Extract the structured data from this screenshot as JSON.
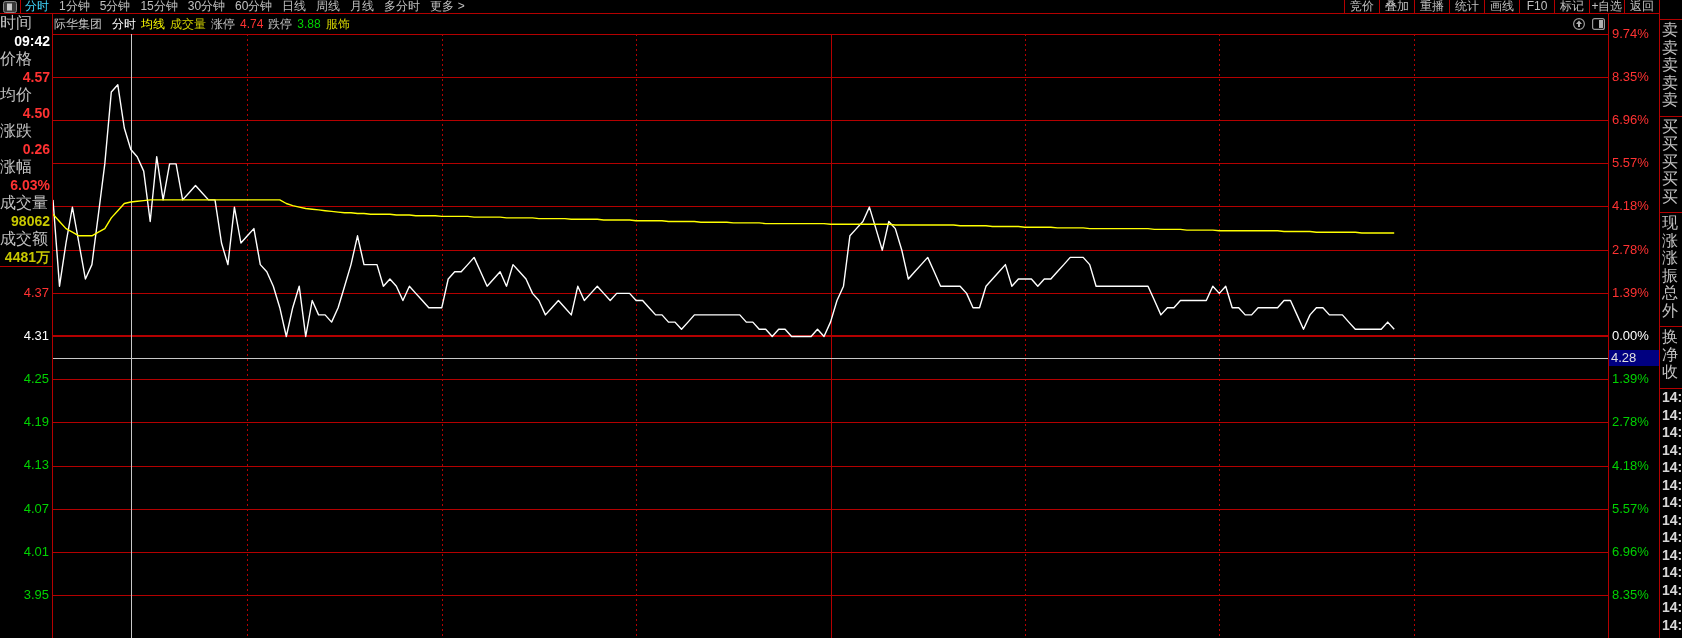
{
  "toolbar": {
    "periods": [
      {
        "label": "分时",
        "selected": true
      },
      {
        "label": "1分钟",
        "selected": false
      },
      {
        "label": "5分钟",
        "selected": false
      },
      {
        "label": "15分钟",
        "selected": false
      },
      {
        "label": "30分钟",
        "selected": false
      },
      {
        "label": "60分钟",
        "selected": false
      },
      {
        "label": "日线",
        "selected": false
      },
      {
        "label": "周线",
        "selected": false
      },
      {
        "label": "月线",
        "selected": false
      },
      {
        "label": "多分时",
        "selected": false
      },
      {
        "label": "更多 >",
        "selected": false
      }
    ],
    "actions": [
      "竞价",
      "叠加",
      "重播",
      "统计",
      "画线",
      "F10",
      "标记",
      "+自选",
      "返回"
    ]
  },
  "info_panel": [
    {
      "label": "时间",
      "value": "09:42",
      "color": "#ffffff"
    },
    {
      "label": "价格",
      "value": "4.57",
      "color": "#ff3232"
    },
    {
      "label": "均价",
      "value": "4.50",
      "color": "#ff3232"
    },
    {
      "label": "涨跌",
      "value": "0.26",
      "color": "#ff3232"
    },
    {
      "label": "涨幅",
      "value": "6.03%",
      "color": "#ff3232"
    },
    {
      "label": "成交量",
      "value": "98062",
      "color": "#c8c800"
    },
    {
      "label": "成交额",
      "value": "4481万",
      "color": "#c8c800"
    }
  ],
  "chart": {
    "stock": "际华集团",
    "legend": [
      {
        "text": "成交量",
        "kind": "indicator"
      },
      {
        "text": "涨停",
        "kind": "label"
      },
      {
        "text": "4.74",
        "kind": "rise"
      },
      {
        "text": "跌停",
        "kind": "label"
      },
      {
        "text": "3.88",
        "kind": "fall"
      },
      {
        "text": "服饰",
        "kind": "tag"
      }
    ],
    "chart_data": {
      "type": "line",
      "grid": true,
      "ylim": [
        3.89,
        4.73
      ],
      "y2lim": [
        -9.74,
        9.74
      ],
      "categories": [
        null,
        null,
        null,
        null,
        null,
        null,
        null,
        null,
        null,
        null,
        null,
        null,
        null,
        null,
        null,
        null,
        null,
        null,
        null,
        null,
        null,
        null,
        null,
        null,
        null,
        null,
        null,
        null,
        null,
        null,
        null,
        null,
        null,
        null,
        null,
        null,
        null,
        null,
        null,
        null,
        null,
        null,
        null,
        null,
        null,
        null,
        null,
        null,
        null,
        null,
        null,
        null,
        null,
        null,
        null,
        null,
        null,
        null,
        null,
        null,
        null,
        null,
        null,
        null,
        null,
        null,
        null,
        null,
        null,
        null,
        null,
        null,
        null,
        null,
        null,
        null,
        null,
        null,
        null,
        null,
        null,
        null,
        null,
        null,
        null,
        null,
        null,
        null,
        null,
        null,
        null,
        null,
        null,
        null,
        null,
        null,
        null,
        null,
        null,
        null,
        null,
        null,
        null,
        null,
        null,
        null,
        null,
        null,
        null,
        null,
        null,
        null,
        null,
        null,
        null,
        null,
        null,
        null,
        null,
        null,
        null,
        null,
        null,
        null,
        null,
        null,
        null,
        null,
        null,
        null,
        null,
        null,
        null,
        null,
        null,
        null,
        null,
        null,
        null,
        null,
        null,
        null,
        null,
        null,
        null,
        null,
        null,
        null,
        null,
        null,
        null,
        null,
        null,
        null,
        null,
        null,
        null,
        null,
        null,
        null,
        null,
        null,
        null,
        null,
        null,
        null,
        null,
        null,
        null,
        null,
        null,
        null,
        null,
        null,
        null,
        null,
        null,
        null,
        null,
        null,
        null,
        null,
        null,
        null,
        null,
        null,
        null,
        null,
        null,
        null,
        null,
        null,
        null,
        null,
        null,
        null,
        null,
        null,
        null,
        null,
        null,
        null,
        null,
        null,
        null,
        null,
        null,
        null,
        null,
        null,
        null,
        null,
        null,
        null,
        null,
        null,
        null,
        null,
        null,
        null,
        null,
        null,
        null,
        null,
        null,
        null,
        null,
        null,
        null,
        null,
        null,
        null,
        null,
        null,
        null,
        null,
        null,
        null,
        null,
        null,
        null
      ],
      "series": [
        {
          "name": "分时",
          "color": "#ffffff",
          "values": [
            4.5,
            4.38,
            4.44,
            4.49,
            4.44,
            4.39,
            4.41,
            4.48,
            4.55,
            4.65,
            4.66,
            4.6,
            4.57,
            4.56,
            4.54,
            4.47,
            4.56,
            4.5,
            4.55,
            4.55,
            4.5,
            4.51,
            4.52,
            4.51,
            4.5,
            4.5,
            4.44,
            4.41,
            4.49,
            4.44,
            4.45,
            4.46,
            4.41,
            4.4,
            4.38,
            4.35,
            4.31,
            4.35,
            4.38,
            4.31,
            4.36,
            4.34,
            4.34,
            4.33,
            4.35,
            4.38,
            4.41,
            4.45,
            4.41,
            4.41,
            4.41,
            4.38,
            4.39,
            4.38,
            4.36,
            4.38,
            4.37,
            4.36,
            4.35,
            4.35,
            4.35,
            4.39,
            4.4,
            4.4,
            4.41,
            4.42,
            4.4,
            4.38,
            4.39,
            4.4,
            4.38,
            4.41,
            4.4,
            4.39,
            4.37,
            4.36,
            4.34,
            4.35,
            4.36,
            4.35,
            4.34,
            4.38,
            4.36,
            4.37,
            4.38,
            4.37,
            4.36,
            4.37,
            4.37,
            4.37,
            4.36,
            4.36,
            4.35,
            4.34,
            4.34,
            4.33,
            4.33,
            4.32,
            4.33,
            4.34,
            4.34,
            4.34,
            4.34,
            4.34,
            4.34,
            4.34,
            4.34,
            4.33,
            4.33,
            4.32,
            4.32,
            4.31,
            4.32,
            4.32,
            4.31,
            4.31,
            4.31,
            4.31,
            4.32,
            4.31,
            4.33,
            4.36,
            4.38,
            4.45,
            4.46,
            4.47,
            4.49,
            4.46,
            4.43,
            4.47,
            4.46,
            4.43,
            4.39,
            4.4,
            4.41,
            4.42,
            4.4,
            4.38,
            4.38,
            4.38,
            4.38,
            4.37,
            4.35,
            4.35,
            4.38,
            4.39,
            4.4,
            4.41,
            4.38,
            4.39,
            4.39,
            4.39,
            4.38,
            4.39,
            4.39,
            4.4,
            4.41,
            4.42,
            4.42,
            4.42,
            4.41,
            4.38,
            4.38,
            4.38,
            4.38,
            4.38,
            4.38,
            4.38,
            4.38,
            4.38,
            4.36,
            4.34,
            4.35,
            4.35,
            4.36,
            4.36,
            4.36,
            4.36,
            4.36,
            4.38,
            4.37,
            4.38,
            4.35,
            4.35,
            4.34,
            4.34,
            4.35,
            4.35,
            4.35,
            4.35,
            4.36,
            4.36,
            4.34,
            4.32,
            4.34,
            4.35,
            4.35,
            4.34,
            4.34,
            4.34,
            4.33,
            4.32,
            4.32,
            4.32,
            4.32,
            4.32,
            4.33,
            4.32,
            null,
            null,
            null,
            null,
            null,
            null,
            null,
            null,
            null,
            null,
            null,
            null,
            null,
            null,
            null,
            null,
            null,
            null,
            null,
            null,
            null,
            null,
            null,
            null,
            null,
            null,
            null,
            null,
            null,
            null,
            null,
            null,
            null
          ]
        },
        {
          "name": "均线",
          "color": "#ffff00",
          "values": [
            4.48,
            4.47,
            4.46,
            4.455,
            4.45,
            4.45,
            4.45,
            4.455,
            4.46,
            4.475,
            4.485,
            4.495,
            4.497,
            4.498,
            4.499,
            4.5,
            4.5,
            4.5,
            4.5,
            4.5,
            4.5,
            4.5,
            4.5,
            4.5,
            4.5,
            4.5,
            4.5,
            4.5,
            4.5,
            4.5,
            4.5,
            4.5,
            4.5,
            4.5,
            4.5,
            4.5,
            4.495,
            4.492,
            4.49,
            4.488,
            4.487,
            4.486,
            4.485,
            4.484,
            4.483,
            4.482,
            4.482,
            4.481,
            4.481,
            4.48,
            4.48,
            4.48,
            4.48,
            4.479,
            4.479,
            4.479,
            4.478,
            4.478,
            4.478,
            4.478,
            4.477,
            4.477,
            4.477,
            4.477,
            4.477,
            4.476,
            4.476,
            4.476,
            4.476,
            4.476,
            4.475,
            4.475,
            4.475,
            4.475,
            4.475,
            4.474,
            4.474,
            4.474,
            4.474,
            4.474,
            4.473,
            4.473,
            4.473,
            4.473,
            4.473,
            4.472,
            4.472,
            4.472,
            4.472,
            4.472,
            4.471,
            4.471,
            4.471,
            4.471,
            4.471,
            4.47,
            4.47,
            4.47,
            4.47,
            4.47,
            4.469,
            4.469,
            4.469,
            4.469,
            4.469,
            4.468,
            4.468,
            4.468,
            4.468,
            4.468,
            4.467,
            4.467,
            4.467,
            4.467,
            4.467,
            4.467,
            4.467,
            4.467,
            4.467,
            4.467,
            4.466,
            4.466,
            4.466,
            4.466,
            4.466,
            4.466,
            4.466,
            4.466,
            4.466,
            4.466,
            4.465,
            4.465,
            4.465,
            4.465,
            4.465,
            4.465,
            4.465,
            4.465,
            4.465,
            4.465,
            4.464,
            4.464,
            4.464,
            4.464,
            4.464,
            4.463,
            4.463,
            4.463,
            4.463,
            4.463,
            4.462,
            4.462,
            4.462,
            4.462,
            4.462,
            4.461,
            4.461,
            4.461,
            4.461,
            4.461,
            4.46,
            4.46,
            4.46,
            4.46,
            4.46,
            4.46,
            4.46,
            4.46,
            4.46,
            4.46,
            4.459,
            4.459,
            4.459,
            4.459,
            4.459,
            4.458,
            4.458,
            4.458,
            4.458,
            4.458,
            4.457,
            4.457,
            4.457,
            4.457,
            4.457,
            4.457,
            4.457,
            4.457,
            4.457,
            4.457,
            4.456,
            4.456,
            4.456,
            4.456,
            4.456,
            4.455,
            4.455,
            4.455,
            4.455,
            4.455,
            4.455,
            4.455,
            4.454,
            4.454,
            4.454,
            4.454,
            4.454,
            4.454,
            null,
            null,
            null,
            null,
            null,
            null,
            null,
            null,
            null,
            null,
            null,
            null,
            null,
            null,
            null,
            null,
            null,
            null,
            null,
            null,
            null,
            null,
            null,
            null,
            null,
            null,
            null,
            null,
            null,
            null,
            null,
            null,
            null
          ]
        }
      ],
      "yticks": [
        {
          "value": 4.37,
          "label": "4.37"
        },
        {
          "value": 4.31,
          "label": "4.31"
        },
        {
          "value": 4.25,
          "label": "4.25"
        },
        {
          "value": 4.19,
          "label": "4.19"
        },
        {
          "value": 4.13,
          "label": "4.13"
        },
        {
          "value": 4.07,
          "label": "4.07"
        },
        {
          "value": 4.01,
          "label": "4.01"
        },
        {
          "value": 3.95,
          "label": "3.95"
        }
      ],
      "y2ticks": [
        {
          "value": 9.74,
          "label": "9.74%"
        },
        {
          "value": 8.35,
          "label": "8.35%"
        },
        {
          "value": 6.96,
          "label": "6.96%"
        },
        {
          "value": 5.57,
          "label": "5.57%"
        },
        {
          "value": 4.18,
          "label": "4.18%"
        },
        {
          "value": 2.78,
          "label": "2.78%"
        },
        {
          "value": 1.39,
          "label": "1.39%"
        },
        {
          "value": 0,
          "label": "0.00%"
        },
        {
          "value": -1.39,
          "label": "1.39%"
        },
        {
          "value": -2.78,
          "label": "2.78%"
        },
        {
          "value": -4.18,
          "label": "4.18%"
        },
        {
          "value": -5.57,
          "label": "5.57%"
        },
        {
          "value": -6.96,
          "label": "6.96%"
        },
        {
          "value": -8.35,
          "label": "8.35%"
        }
      ],
      "ref_lines": [
        {
          "axis": "y",
          "value": 4.31,
          "color": "#b40000"
        },
        {
          "axis": "y",
          "value": 4.28,
          "color": "#c8c8c8",
          "label": "4.28"
        }
      ]
    }
  },
  "side_panel": [
    {
      "kind": "label",
      "rows": [
        "卖",
        "卖",
        "卖",
        "卖",
        "卖"
      ]
    },
    {
      "kind": "label",
      "rows": [
        "买",
        "买",
        "买",
        "买",
        "买"
      ]
    },
    {
      "kind": "label",
      "rows": [
        "现",
        "涨",
        "涨",
        "振",
        "总",
        "外"
      ]
    },
    {
      "kind": "label",
      "rows": [
        "换",
        "净",
        "收"
      ]
    },
    {
      "kind": "time",
      "rows": [
        "14:",
        "14:",
        "14:",
        "14:",
        "14:",
        "14:",
        "14:",
        "14:",
        "14:",
        "14:",
        "14:",
        "14:",
        "14:",
        "14:"
      ]
    }
  ]
}
